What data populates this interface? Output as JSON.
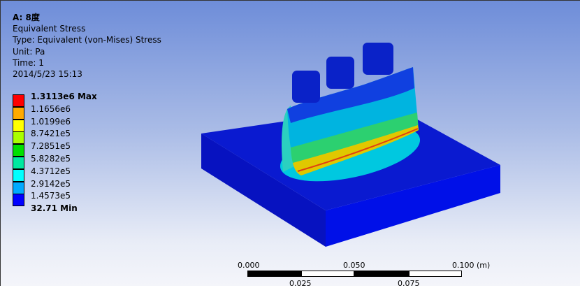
{
  "header": {
    "title": "A: 8度",
    "result": "Equivalent Stress",
    "type": "Type: Equivalent (von-Mises) Stress",
    "unit": "Unit: Pa",
    "time": "Time: 1",
    "date": "2014/5/23 15:13"
  },
  "legend": {
    "labels": [
      "1.3113e6 Max",
      "1.1656e6",
      "1.0199e6",
      "8.7421e5",
      "7.2851e5",
      "5.8282e5",
      "4.3712e5",
      "2.9142e5",
      "1.4573e5",
      "32.71 Min"
    ],
    "colors": [
      "#ff0000",
      "#ffaa00",
      "#ffff00",
      "#aaff00",
      "#00e000",
      "#00e8a0",
      "#00ffff",
      "#00aaff",
      "#0000ff"
    ]
  },
  "scale_bar": {
    "top_labels": [
      "0.000",
      "0.050",
      "0.100 (m)"
    ],
    "bottom_labels": [
      "0.025",
      "0.075"
    ]
  }
}
